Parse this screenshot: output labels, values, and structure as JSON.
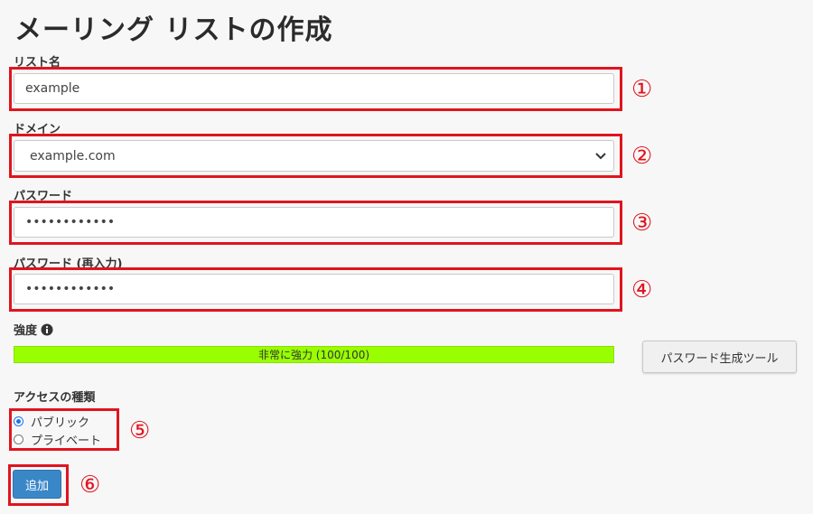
{
  "page": {
    "title": "メーリング リストの作成"
  },
  "form": {
    "list_name": {
      "label": "リスト名",
      "value": "example",
      "marker": "①"
    },
    "domain": {
      "label": "ドメイン",
      "value": "example.com",
      "marker": "②"
    },
    "password": {
      "label": "パスワード",
      "value": "••••••••••••",
      "marker": "③"
    },
    "password_confirm": {
      "label": "パスワード (再入力)",
      "value": "••••••••••••",
      "marker": "④"
    },
    "strength": {
      "label": "強度",
      "text": "非常に強力 (100/100)",
      "score": 100,
      "bar_color": "#99ff00"
    },
    "generator_button": "パスワード生成ツール",
    "access": {
      "label": "アクセスの種類",
      "options": [
        {
          "label": "パブリック",
          "selected": true
        },
        {
          "label": "プライベート",
          "selected": false
        }
      ],
      "marker": "⑤"
    },
    "submit": {
      "label": "追加",
      "marker": "⑥",
      "color": "#3a87c8"
    }
  },
  "annotation_color": "#e0141e"
}
